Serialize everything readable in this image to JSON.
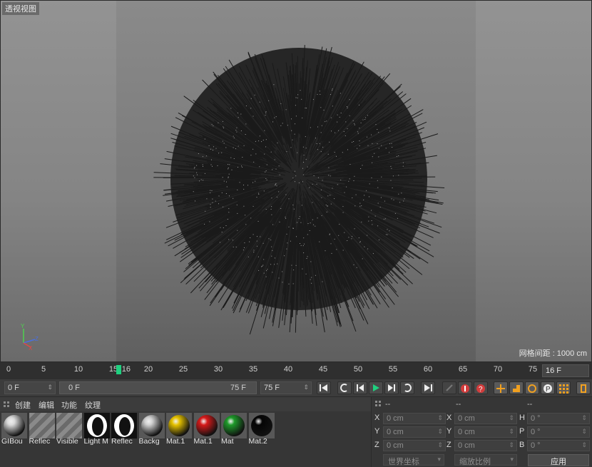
{
  "viewport": {
    "title": "透视视图",
    "grid_spacing": "网格间距 : 1000 cm",
    "axis": {
      "y": "Y",
      "z": "Z",
      "x": "X"
    }
  },
  "timeline": {
    "ticks": [
      "0",
      "5",
      "10",
      "15",
      "20",
      "25",
      "30",
      "35",
      "40",
      "45",
      "50",
      "55",
      "60",
      "65",
      "70",
      "75"
    ],
    "playhead": "16",
    "current_frame": "16 F"
  },
  "transport": {
    "start": "0 F",
    "range_start": "0 F",
    "range_end": "75 F",
    "end": "75 F"
  },
  "material_manager": {
    "menu": [
      "创建",
      "编辑",
      "功能",
      "纹理"
    ],
    "materials": [
      {
        "label": "GIBou",
        "kind": "sphere",
        "color": "#d9d9d9"
      },
      {
        "label": "Reflec",
        "kind": "stripes",
        "color": "#8a8a8a"
      },
      {
        "label": "Visible",
        "kind": "stripes",
        "color": "#8a8a8a"
      },
      {
        "label": "Light M",
        "kind": "bw",
        "color": "#ffffff"
      },
      {
        "label": "Reflec",
        "kind": "bw",
        "color": "#ffffff"
      },
      {
        "label": "Backg",
        "kind": "sphere",
        "color": "#cfcfcf"
      },
      {
        "label": "Mat.1",
        "kind": "sphere",
        "color": "#e6c200"
      },
      {
        "label": "Mat.1",
        "kind": "sphere",
        "color": "#d61a1a"
      },
      {
        "label": "Mat",
        "kind": "sphere",
        "color": "#1e9a2a"
      },
      {
        "label": "Mat.2",
        "kind": "sphere",
        "color": "#050505"
      }
    ]
  },
  "coordinates": {
    "headers": [
      "--",
      "--",
      "--"
    ],
    "rows": [
      {
        "a": "X",
        "av": "0 cm",
        "b": "X",
        "bv": "0 cm",
        "c": "H",
        "cv": "0 °"
      },
      {
        "a": "Y",
        "av": "0 cm",
        "b": "Y",
        "bv": "0 cm",
        "c": "P",
        "cv": "0 °"
      },
      {
        "a": "Z",
        "av": "0 cm",
        "b": "Z",
        "bv": "0 cm",
        "c": "B",
        "cv": "0 °"
      }
    ],
    "world_select": "世界坐标",
    "scale_select": "缩放比例",
    "apply": "应用"
  },
  "colors": {
    "accent": "#1fd07f",
    "toolbar_orange": "#f0a020",
    "record_red": "#d23c3c"
  }
}
